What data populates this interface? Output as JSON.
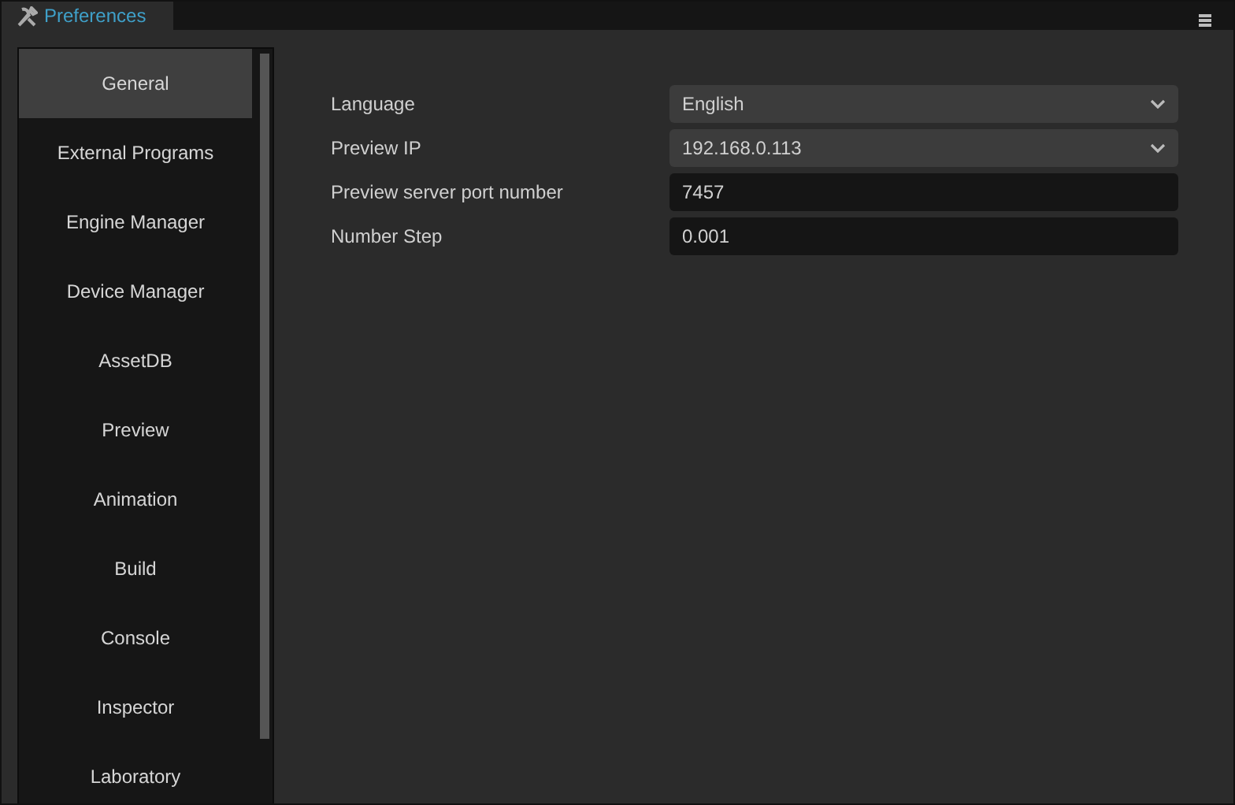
{
  "tab": {
    "title": "Preferences",
    "selected": true
  },
  "sidebar": {
    "items": [
      {
        "label": "General",
        "selected": true
      },
      {
        "label": "External Programs",
        "selected": false
      },
      {
        "label": "Engine Manager",
        "selected": false
      },
      {
        "label": "Device Manager",
        "selected": false
      },
      {
        "label": "AssetDB",
        "selected": false
      },
      {
        "label": "Preview",
        "selected": false
      },
      {
        "label": "Animation",
        "selected": false
      },
      {
        "label": "Build",
        "selected": false
      },
      {
        "label": "Console",
        "selected": false
      },
      {
        "label": "Inspector",
        "selected": false
      },
      {
        "label": "Laboratory",
        "selected": false
      }
    ]
  },
  "settings": [
    {
      "label": "Language",
      "kind": "select",
      "value": "English"
    },
    {
      "label": "Preview IP",
      "kind": "select",
      "value": "192.168.0.113"
    },
    {
      "label": "Preview server port number",
      "kind": "input",
      "value": "7457"
    },
    {
      "label": "Number Step",
      "kind": "input",
      "value": "0.001"
    }
  ]
}
